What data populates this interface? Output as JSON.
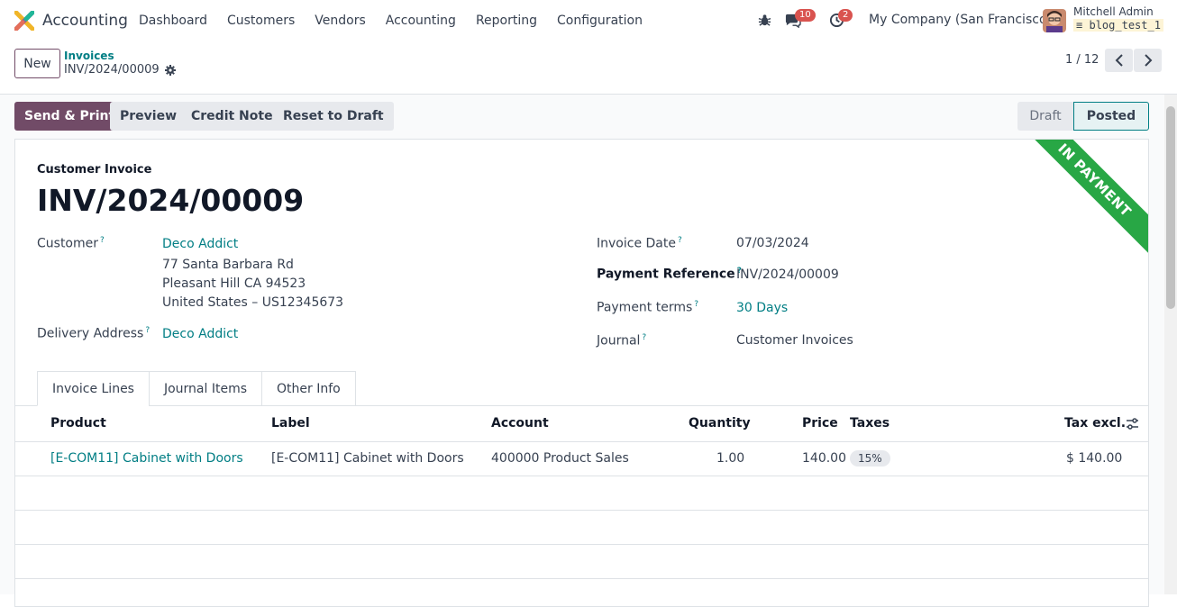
{
  "navbar": {
    "app_name": "Accounting",
    "menu": [
      "Dashboard",
      "Customers",
      "Vendors",
      "Accounting",
      "Reporting",
      "Configuration"
    ],
    "chat_count": "10",
    "activity_count": "2",
    "company": "My Company (San Francisco)",
    "user_name": "Mitchell Admin",
    "db_name": "blog_test_1"
  },
  "control_panel": {
    "new_label": "New",
    "breadcrumb_parent": "Invoices",
    "breadcrumb_current": "INV/2024/00009",
    "pager": "1 / 12"
  },
  "actions": {
    "send_print": "Send & Print",
    "preview": "Preview",
    "credit_note": "Credit Note",
    "reset_draft": "Reset to Draft"
  },
  "statusbar": {
    "draft": "Draft",
    "posted": "Posted"
  },
  "ribbon": "IN PAYMENT",
  "invoice": {
    "doc_type": "Customer Invoice",
    "name": "INV/2024/00009",
    "customer_label": "Customer",
    "customer": "Deco Addict",
    "address_line1": "77 Santa Barbara Rd",
    "address_line2": "Pleasant Hill CA 94523",
    "address_line3": "United States – US12345673",
    "delivery_label": "Delivery Address",
    "delivery": "Deco Addict",
    "invoice_date_label": "Invoice Date",
    "invoice_date": "07/03/2024",
    "payment_ref_label": "Payment Reference",
    "payment_ref": "INV/2024/00009",
    "payment_terms_label": "Payment terms",
    "payment_terms": "30 Days",
    "journal_label": "Journal",
    "journal": "Customer Invoices",
    "help_mark": "?"
  },
  "tabs": [
    "Invoice Lines",
    "Journal Items",
    "Other Info"
  ],
  "table": {
    "headers": {
      "product": "Product",
      "label": "Label",
      "account": "Account",
      "quantity": "Quantity",
      "price": "Price",
      "taxes": "Taxes",
      "tax_excl": "Tax excl."
    },
    "rows": [
      {
        "product": "[E-COM11] Cabinet with Doors",
        "label": "[E-COM11] Cabinet with Doors",
        "account": "400000 Product Sales",
        "quantity": "1.00",
        "price": "140.00",
        "taxes": "15%",
        "tax_excl": "$ 140.00"
      }
    ]
  },
  "colors": {
    "primary": "#714b67",
    "link": "#017e84",
    "ribbon": "#28a745",
    "badge": "#d9534f"
  }
}
